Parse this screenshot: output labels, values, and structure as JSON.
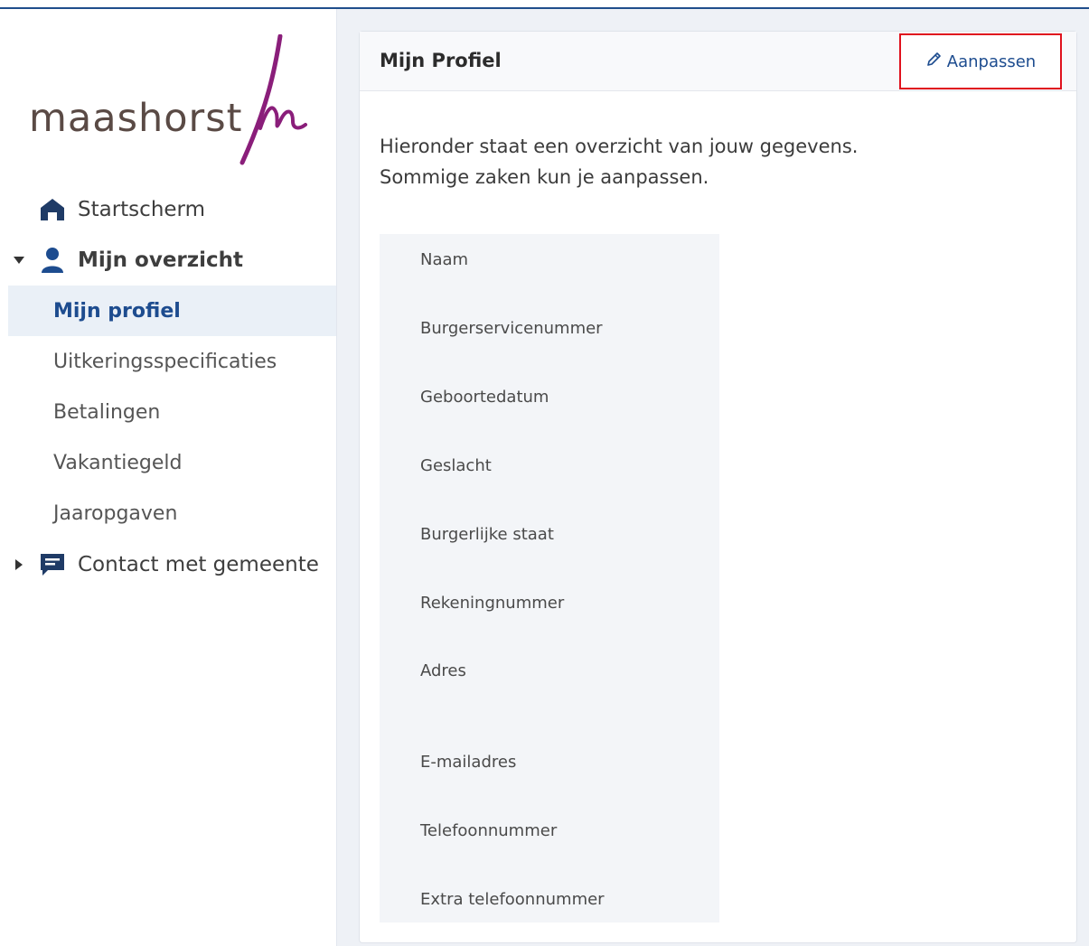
{
  "logo": {
    "text": "maashorst",
    "colors": {
      "text": "#5a4a45",
      "mark": "#8a1e7a"
    }
  },
  "sidebar": {
    "items": [
      {
        "label": "Startscherm",
        "icon": "home-icon"
      },
      {
        "label": "Mijn overzicht",
        "icon": "person-icon",
        "expanded": true
      },
      {
        "label": "Mijn profiel",
        "active": true
      },
      {
        "label": "Uitkeringsspecificaties"
      },
      {
        "label": "Betalingen"
      },
      {
        "label": "Vakantiegeld"
      },
      {
        "label": "Jaaropgaven"
      },
      {
        "label": "Contact met gemeente",
        "icon": "chat-icon",
        "expanded": false
      }
    ]
  },
  "card": {
    "title": "Mijn Profiel",
    "edit_label": "Aanpassen",
    "intro_line1": "Hieronder staat een overzicht van jouw gegevens.",
    "intro_line2": "Sommige zaken kun je aanpassen.",
    "fields": [
      "Naam",
      "Burgerservicenummer",
      "Geboortedatum",
      "Geslacht",
      "Burgerlijke staat",
      "Rekeningnummer",
      "Adres",
      "E-mailadres",
      "Telefoonnummer",
      "Extra telefoonnummer"
    ]
  },
  "colors": {
    "accent": "#1d4c8f",
    "highlight_border": "#e0121e",
    "main_bg": "#eef1f6"
  }
}
